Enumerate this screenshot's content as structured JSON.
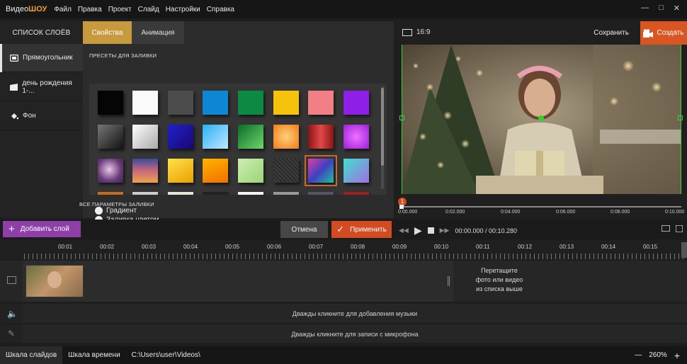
{
  "app": {
    "logo_part1": "Видео",
    "logo_part2": "ШОУ"
  },
  "menu": [
    "Файл",
    "Правка",
    "Проект",
    "Слайд",
    "Настройки",
    "Справка"
  ],
  "layers": {
    "header": "СПИСОК СЛОЁВ",
    "items": [
      {
        "label": "Прямоугольник",
        "icon": "rectangle-icon"
      },
      {
        "label": "день рождения 1-...",
        "icon": "film-icon"
      },
      {
        "label": "Фон",
        "icon": "paint-bucket-icon"
      }
    ]
  },
  "tabs": {
    "properties": "Свойства",
    "animation": "Анимация"
  },
  "properties": {
    "presets_label": "ПРЕСЕТЫ ДЛЯ ЗАЛИВКИ",
    "all_params_label": "ВСЕ ПАРАМЕТРЫ ЗАЛИВКИ",
    "radio_fill": "Заливка цветом",
    "radio_gradient": "Градиент"
  },
  "preview": {
    "ratio": "16:9",
    "save": "Сохранить",
    "create": "Создать",
    "time_marks": [
      "0:00.000",
      "0:02.000",
      "0:04.000",
      "0:06.000",
      "0:08.000",
      "0:10.000"
    ],
    "marker": "1"
  },
  "controls": {
    "add_layer": "Добавить слой",
    "cancel": "Отмена",
    "apply": "Применить",
    "time": "00:00.000 / 00:10.280"
  },
  "ruler": [
    "00:01",
    "00:02",
    "00:03",
    "00:04",
    "00:05",
    "00:06",
    "00:07",
    "00:08",
    "00:09",
    "00:10",
    "00:11",
    "00:12",
    "00:13",
    "00:14",
    "00:15"
  ],
  "tracks": {
    "drop_hint_line1": "Перетащите",
    "drop_hint_line2": "фото или видео",
    "drop_hint_line3": "из списка выше",
    "music": "Дважды кликните для добавления музыки",
    "mic": "Дважды кликните для записи с микрофона"
  },
  "status": {
    "slides_tab": "Шкала слайдов",
    "timeline_tab": "Шкала времени",
    "path": "C:\\Users\\user\\Videos\\",
    "zoom": "260%"
  }
}
